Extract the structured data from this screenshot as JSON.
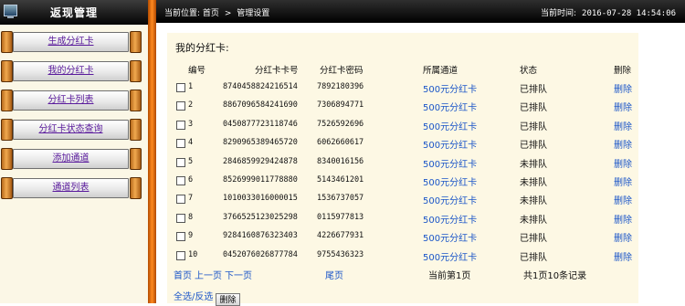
{
  "sidebar": {
    "title": "返现管理",
    "items": [
      {
        "label": "生成分红卡"
      },
      {
        "label": "我的分红卡"
      },
      {
        "label": "分红卡列表"
      },
      {
        "label": "分红卡状态查询"
      },
      {
        "label": "添加通道"
      },
      {
        "label": "通道列表"
      }
    ]
  },
  "header": {
    "location_label": "当前位置:",
    "crumbs": [
      "首页",
      "管理设置"
    ],
    "crumb_separator": ">",
    "time_label": "当前时间:",
    "time_value": "2016-07-28 14:54:06"
  },
  "panel": {
    "title": "我的分红卡:",
    "columns": [
      "编号",
      "分红卡卡号",
      "分红卡密码",
      "所属通道",
      "状态",
      "删除"
    ],
    "rows": [
      {
        "id": "1",
        "card_no": "8740458824216514",
        "password": "7892180396",
        "channel": "500元分红卡",
        "status": "已排队",
        "action": "删除"
      },
      {
        "id": "2",
        "card_no": "8867096584241690",
        "password": "7306894771",
        "channel": "500元分红卡",
        "status": "已排队",
        "action": "删除"
      },
      {
        "id": "3",
        "card_no": "0450877723118746",
        "password": "7526592696",
        "channel": "500元分红卡",
        "status": "已排队",
        "action": "删除"
      },
      {
        "id": "4",
        "card_no": "8290965389465720",
        "password": "6062660617",
        "channel": "500元分红卡",
        "status": "已排队",
        "action": "删除"
      },
      {
        "id": "5",
        "card_no": "2846859929424878",
        "password": "8340016156",
        "channel": "500元分红卡",
        "status": "未排队",
        "action": "删除"
      },
      {
        "id": "6",
        "card_no": "8526999011778880",
        "password": "5143461201",
        "channel": "500元分红卡",
        "status": "未排队",
        "action": "删除"
      },
      {
        "id": "7",
        "card_no": "1010033016000015",
        "password": "1536737057",
        "channel": "500元分红卡",
        "status": "未排队",
        "action": "删除"
      },
      {
        "id": "8",
        "card_no": "3766525123025298",
        "password": "0115977813",
        "channel": "500元分红卡",
        "status": "未排队",
        "action": "删除"
      },
      {
        "id": "9",
        "card_no": "9284160876323403",
        "password": "4226677931",
        "channel": "500元分红卡",
        "status": "已排队",
        "action": "删除"
      },
      {
        "id": "10",
        "card_no": "0452076026877784",
        "password": "9755436323",
        "channel": "500元分红卡",
        "status": "已排队",
        "action": "删除"
      }
    ],
    "pager": {
      "first": "首页",
      "prev": "上一页",
      "next": "下一页",
      "last": "尾页",
      "current": "当前第1页",
      "summary": "共1页10条记录"
    },
    "select_toggle": "全选/反选",
    "delete_button": "删除"
  },
  "colors": {
    "accent_orange": "#ff8a20",
    "link_blue": "#1a55c8",
    "menu_link_purple": "#5a1b9c",
    "panel_bg": "#fdf8e4"
  }
}
